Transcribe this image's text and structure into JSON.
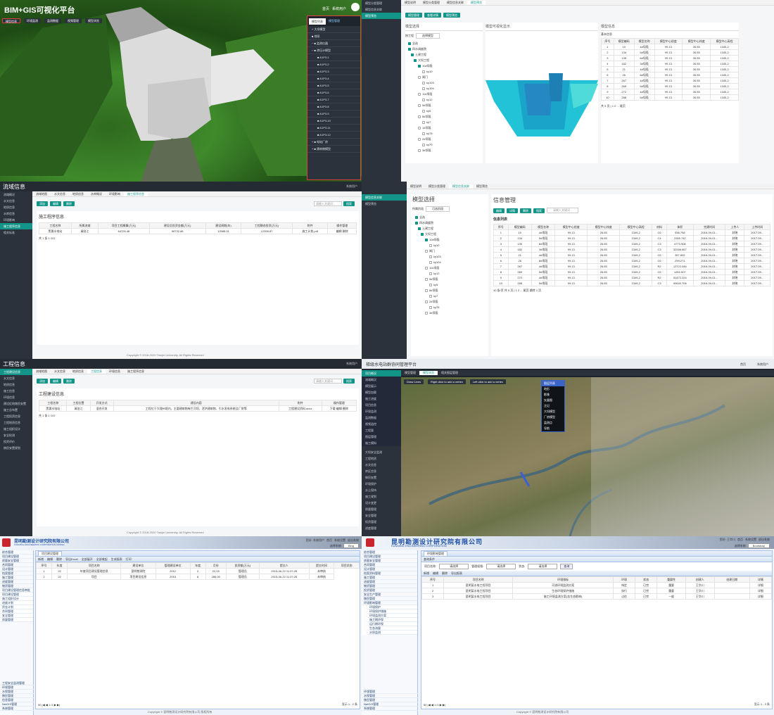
{
  "p1": {
    "title": "BIM+GIS可视化平台",
    "header_links": [
      "首页",
      "系统用户"
    ],
    "top_buttons": [
      "模型信息",
      "环境监测",
      "监测数据",
      "视频管理",
      "模型浏览"
    ],
    "dropdown": {
      "tabs": [
        "模型列表",
        "模型管理"
      ],
      "groups": [
        "+ 大坝模型",
        "■ 地形",
        "− ■ 监测仪器",
        "− ■ 渗压计模型"
      ],
      "items": [
        "A1P3-1",
        "A1P3-2",
        "A1P3-3",
        "A1P3-4",
        "A1P3-5",
        "A1P3-6",
        "A1P3-7",
        "A1P3-8",
        "A1P3-9",
        "A1P3-10",
        "A1P3-11",
        "A1P3-12"
      ],
      "footer": [
        "+ ■ 电站厂房",
        "+ ■ 建筑物模型"
      ]
    }
  },
  "p2": {
    "sidebar": [
      "模型分类管理",
      "模型信息关联",
      "模型预览"
    ],
    "tabs": [
      "模型说明",
      "模型分类管理",
      "模型信息关联",
      "模型预览"
    ],
    "toolbar": [
      "模型管理",
      "查看详情",
      "模型预览"
    ],
    "section_select": "模型选择",
    "section_view": "模型可视化显示",
    "section_info": "模型信息",
    "filter_labels": [
      "按工程",
      "选择模型"
    ],
    "tree": [
      "全选",
      "四水调度院",
      "土建工程",
      "大坝工程",
      "10#坝段",
      "ky10",
      "闸门",
      "ky103",
      "ky104",
      "11#坝段",
      "ky12",
      "5#坝段",
      "ky5",
      "8#坝段",
      "ky7",
      "1#坝段",
      "ky78",
      "2#坝段",
      "ky79",
      "3#坝段"
    ],
    "info_subtitle": "基本信息",
    "columns": [
      "序号",
      "模型编码",
      "模型名称",
      "模型中心经度",
      "模型中心纬度",
      "模型中心高程"
    ],
    "rows": [
      [
        "1",
        "10",
        "4#坝段",
        "99.13",
        "26.55",
        "1345.2"
      ],
      [
        "2",
        "134",
        "5#坝段",
        "99.13",
        "26.55",
        "1345.2"
      ],
      [
        "3",
        "135",
        "6#坝段",
        "99.13",
        "26.55",
        "1345.2"
      ],
      [
        "4",
        "182",
        "3#坝段",
        "99.13",
        "26.55",
        "1345.2"
      ],
      [
        "5",
        "21",
        "4#坝段",
        "99.13",
        "26.55",
        "1345.2"
      ],
      [
        "6",
        "26",
        "8#坝段",
        "99.13",
        "26.55",
        "1345.2"
      ],
      [
        "7",
        "267",
        "4#坝段",
        "99.13",
        "26.55",
        "1345.2"
      ],
      [
        "8",
        "269",
        "5#坝段",
        "99.13",
        "26.55",
        "1345.2"
      ],
      [
        "9",
        "272",
        "4#坝段",
        "99.13",
        "26.55",
        "1345.2"
      ],
      [
        "10",
        "288",
        "5#坝段",
        "99.13",
        "26.55",
        "1345.2"
      ]
    ],
    "pager": "共 5 页 | 1 2 ... 尾页"
  },
  "p3": {
    "title": "流域信息",
    "user": "系统用户",
    "sidebar": [
      "流域概况",
      "水文信息",
      "地质信息",
      "水库信息",
      "环境影响",
      "施工程序信息",
      "相关标准"
    ],
    "tabs": [
      "流域地图",
      "水文信息",
      "地质信息",
      "水库概况",
      "环境影响",
      "施工程序信息"
    ],
    "toolbar": [
      "添加",
      "编辑",
      "删除"
    ],
    "search_placeholder": "请输入关键词...",
    "search_btn": "搜索",
    "section": "施工程序信息",
    "columns": [
      "工程名称",
      "所属流域",
      "项目工程概算(万元)",
      "建设总投资金额(万元)",
      "建设周期(年)",
      "工程静态投资(万元)",
      "附件",
      "操作管理"
    ],
    "row": [
      "黑惠水电站",
      "澜沧江",
      "64726.48",
      "98732.66",
      "12588.01",
      "12358.87",
      "施工计划.pdf",
      "编辑 删除"
    ],
    "pager": "共 1 条  1  GO",
    "footer": "Copyright © 2018-2020 Tianjin University. All Rights Reserved"
  },
  "p4": {
    "sidebar": [
      "模型信息关联",
      "模型预览"
    ],
    "tabs": [
      "模型说明",
      "模型分类管理",
      "模型信息关联",
      "模型预览"
    ],
    "section_select": "模型选择",
    "section_info": "信息管理",
    "filter_labels": [
      "所属阶段",
      "可选阶段"
    ],
    "toolbar": [
      "编辑",
      "详情",
      "删除",
      "搜索"
    ],
    "search_placeholder": "请输入关键词...",
    "list_title": "信息列表",
    "tree": [
      "全选",
      "四水调度院",
      "土建工程",
      "大坝工程",
      "10#坝段",
      "ky10",
      "闸门",
      "ky103",
      "ky104",
      "11#坝段",
      "ky12",
      "5#坝段",
      "ky5",
      "8#坝段",
      "ky7",
      "2#坝段",
      "ky78",
      "3#坝段"
    ],
    "columns": [
      "序号",
      "模型编码",
      "模型名称",
      "模型中心经度",
      "模型中心纬度",
      "模型中心高程",
      "材料",
      "体积",
      "完建时间",
      "上传人",
      "上传时间"
    ],
    "rows": [
      [
        "1",
        "10",
        "4#坝段",
        "99.13",
        "26.55",
        "1345.2",
        "C6",
        "538.758",
        "2016-09-01...",
        "封晓",
        "2017-09..."
      ],
      [
        "2",
        "134",
        "5#坝段",
        "99.13",
        "26.55",
        "1345.2",
        "C4",
        "2265.742",
        "2016-09-01...",
        "封晓",
        "2017-09..."
      ],
      [
        "3",
        "135",
        "6#坝段",
        "99.13",
        "26.55",
        "1345.2",
        "C3",
        "4773.908",
        "2016-09-01...",
        "封晓",
        "2017-09..."
      ],
      [
        "4",
        "182",
        "3#坝段",
        "99.13",
        "26.55",
        "1345.2",
        "C3",
        "32266.657",
        "2016-09-01...",
        "封晓",
        "2017-09..."
      ],
      [
        "5",
        "21",
        "4#坝段",
        "99.13",
        "26.55",
        "1345.2",
        "C6",
        "357.892",
        "2016-09-01...",
        "封晓",
        "2017-09..."
      ],
      [
        "6",
        "26",
        "8#坝段",
        "99.13",
        "26.55",
        "1345.2",
        "C6",
        "299.271",
        "2016-09-01...",
        "封晓",
        "2017-09..."
      ],
      [
        "7",
        "267",
        "4#坝段",
        "99.13",
        "26.55",
        "1345.2",
        "R2",
        "12722.046",
        "2016-09-01...",
        "封晓",
        "2017-09..."
      ],
      [
        "8",
        "269",
        "5#坝段",
        "99.13",
        "26.55",
        "1345.2",
        "C6",
        "1262.507",
        "2016-09-01...",
        "封晓",
        "2017-09..."
      ],
      [
        "9",
        "272",
        "4#坝段",
        "99.13",
        "26.55",
        "1345.2",
        "R2",
        "51472.224",
        "2016-09-01...",
        "封晓",
        "2017-09..."
      ],
      [
        "10",
        "288",
        "5#坝段",
        "99.13",
        "26.55",
        "1345.2",
        "C3",
        "90640.706",
        "2016-09-01...",
        "封晓",
        "2017-09..."
      ]
    ],
    "pager": "10 条/页  共 5 页 | 1 2 ... 尾页  跳转 1 页"
  },
  "p5": {
    "title": "工程信息",
    "user": "系统用户",
    "sidebar": [
      "工程建设信息",
      "水文信息",
      "地质信息",
      "施工信息",
      "环境信息",
      "建设征地移民安置",
      "施工总布置",
      "工程投资信息",
      "工程地质信息",
      "施工组织设计",
      "安全检测",
      "投资评价",
      "移民安置规划"
    ],
    "tabs": [
      "流域地图",
      "水文信息",
      "地质信息",
      "工程信息",
      "环境信息",
      "施工程序信息"
    ],
    "toolbar": [
      "添加",
      "编辑",
      "删除"
    ],
    "search_placeholder": "请输入关键词...",
    "search_btn": "搜索",
    "section": "工程建设信息",
    "columns": [
      "工程名称",
      "工程位置",
      "开发方式",
      "建设内容",
      "附件",
      "操作管理"
    ],
    "row": [
      "黑惠水电站",
      "澜沧江",
      "混合开发",
      "工程位于大理州境内，主要建筑物有拦河坝、泄洪建筑物、引水发电系统及厂房等",
      "工程建设资料.docx",
      "下载 编辑 删除"
    ],
    "pager": "共 1 条  1  GO",
    "footer": "Copyright © 2018-2020 Tianjin University. All Rights Reserved"
  },
  "p6": {
    "title": "梯级水电站群协同管理平台",
    "header_links": [
      "首页",
      "系统用户"
    ],
    "tabs": [
      "模型管理",
      "模型浏览",
      "相关图层管理"
    ],
    "sidebar_top": [
      "项目概况",
      "流域概况",
      "模型展示",
      "模型加载",
      "施工进度",
      "项目信息",
      "环境监测",
      "监测数据",
      "视频监控",
      "工程量",
      "图层管理",
      "施工模拟"
    ],
    "sidebar_bottom": [
      "大坝安全监测",
      "工程地质",
      "水文信息",
      "库区信息",
      "移民安置",
      "环境保护",
      "水土保持",
      "施工规划",
      "设计变更",
      "质量管理",
      "安全管理",
      "投资管理",
      "进度管理"
    ],
    "map_toolbar": [
      "Draw Lines",
      "Right click to add a vertex",
      "Left click to add a vertex"
    ],
    "map_menu": [
      "图层列表",
      "地形",
      "影像",
      "矢量图",
      "注记",
      "大坝模型",
      "厂房模型",
      "监测点",
      "导航"
    ]
  },
  "p7": {
    "org": "昆明勘测设计研究院有限公司",
    "org_en": "KUNMING ENGINEERING CORPORATION LIMITED",
    "header_right": [
      "您好: 系统用户",
      "首页",
      "系统设置",
      "退出系统"
    ],
    "sub_right": [
      "选择系统:",
      "Bing"
    ],
    "tab": "项目建设管理",
    "sidebar": [
      "综合管理",
      "项目建设管理",
      "质量安全管理",
      "合同管理",
      "设计管理",
      "档案管理",
      "施工管理",
      "进度管理",
      "物资管理"
    ],
    "sidebar_bottom": [
      "工程安全监测管理",
      "环境管理",
      "水保管理",
      "移民管理",
      "信息管理",
      "NetGIS管理",
      "系统管理"
    ],
    "submenu": [
      "项目建设管理信息审批",
      "项目建设管理",
      "施工组织设计",
      "进度计划",
      "资金计划",
      "合同管理",
      "安全管理",
      "质量管理"
    ],
    "flyout": [
      "项目建设管理信息审批",
      "项目基础信息",
      "建设单位信息",
      "环境影响评价",
      "安全生产责任",
      "投资控制",
      "进度控制",
      "质量安全体系",
      "项目竣工验收及资料管理"
    ],
    "toolbar": [
      "新增",
      "编辑",
      "删除",
      "导出Excel",
      "全部展开",
      "全部收起",
      "生成报表",
      "打印"
    ],
    "columns": [
      "序号",
      "年度",
      "项目名称",
      "建设单位",
      "管理建设单位",
      "年度",
      "月份",
      "投资额(万元)",
      "提交人",
      "提交时间",
      "项目状态"
    ],
    "rows": [
      [
        "1",
        "22",
        "年度项目建设管理信息",
        "昆明勘测院",
        "2012",
        "2",
        "22.00",
        "管理员",
        "2015-06-22 11:37:26",
        "未审核"
      ],
      [
        "2",
        "22",
        "项目",
        "项目建设信息",
        "2015",
        "8",
        "286.00",
        "管理员",
        "2015-06-22 11:37:26",
        "未审核"
      ]
    ],
    "pager": "50  |◀ ◀ 1 /1 ▶ ▶|",
    "pager_right": "显示 1 - 2 条",
    "footer": "Copyright © 昆明勘测设计研究院有限公司 版权所有"
  },
  "p8": {
    "org": "昆明勘测设计研究院有限公司",
    "org_en": "KUNMING ENGINEERING CORPORATION",
    "header_right": [
      "您好: 王华川",
      "首页",
      "系统设置",
      "退出系统"
    ],
    "sub_right": [
      "选择系统:",
      "Bootstrap"
    ],
    "tab": "环境影响管理",
    "subtab": "查询条件",
    "filters": [
      "项目名称:",
      "请选择",
      "管理权限:",
      "请选择",
      "状态:",
      "请选择",
      "查询"
    ],
    "sidebar": [
      "综合管理",
      "项目建设管理",
      "质量安全管理",
      "合同管理",
      "设计管理",
      "档案资料管理",
      "施工管理",
      "进度管理",
      "物资管理",
      "投资管理",
      "安全生产管理",
      "移民管理",
      "环境影响管理"
    ],
    "submenu": [
      "环境保护",
      "环境保护措施",
      "环境监测方案",
      "施工期环保",
      "运行期环保",
      "生态流量",
      "水质监测"
    ],
    "sidebar_bottom": [
      "环境管理",
      "水保管理",
      "移民管理",
      "NetGIS管理",
      "系统管理"
    ],
    "toolbar": [
      "新增",
      "编辑",
      "删除",
      "导出报表"
    ],
    "columns": [
      "序号",
      "项目名称",
      "环境指标",
      "环境",
      "状态",
      "重要性",
      "创建人",
      "创建日期",
      "详情"
    ],
    "rows": [
      [
        "1",
        "昆明某水电工程项目",
        "河流环境监测方案",
        "待定",
        "已完",
        "重要",
        "王华川",
        "",
        "详细"
      ],
      [
        "2",
        "昆明某水电工程项目",
        "生态环境保护措施",
        "执行",
        "已完",
        "重要",
        "王华川",
        "",
        "详细"
      ],
      [
        "3",
        "昆明某水电工程项目",
        "施工环境监测方案(含生态影响)",
        "过往",
        "已完",
        "一般",
        "王华川",
        "",
        "详细"
      ]
    ],
    "pager": "50  |◀ ◀ 1 /1 ▶ ▶|",
    "pager_right": "显示 1 - 3 条",
    "footer": "Copyright © 昆明勘测设计研究院有限公司"
  }
}
